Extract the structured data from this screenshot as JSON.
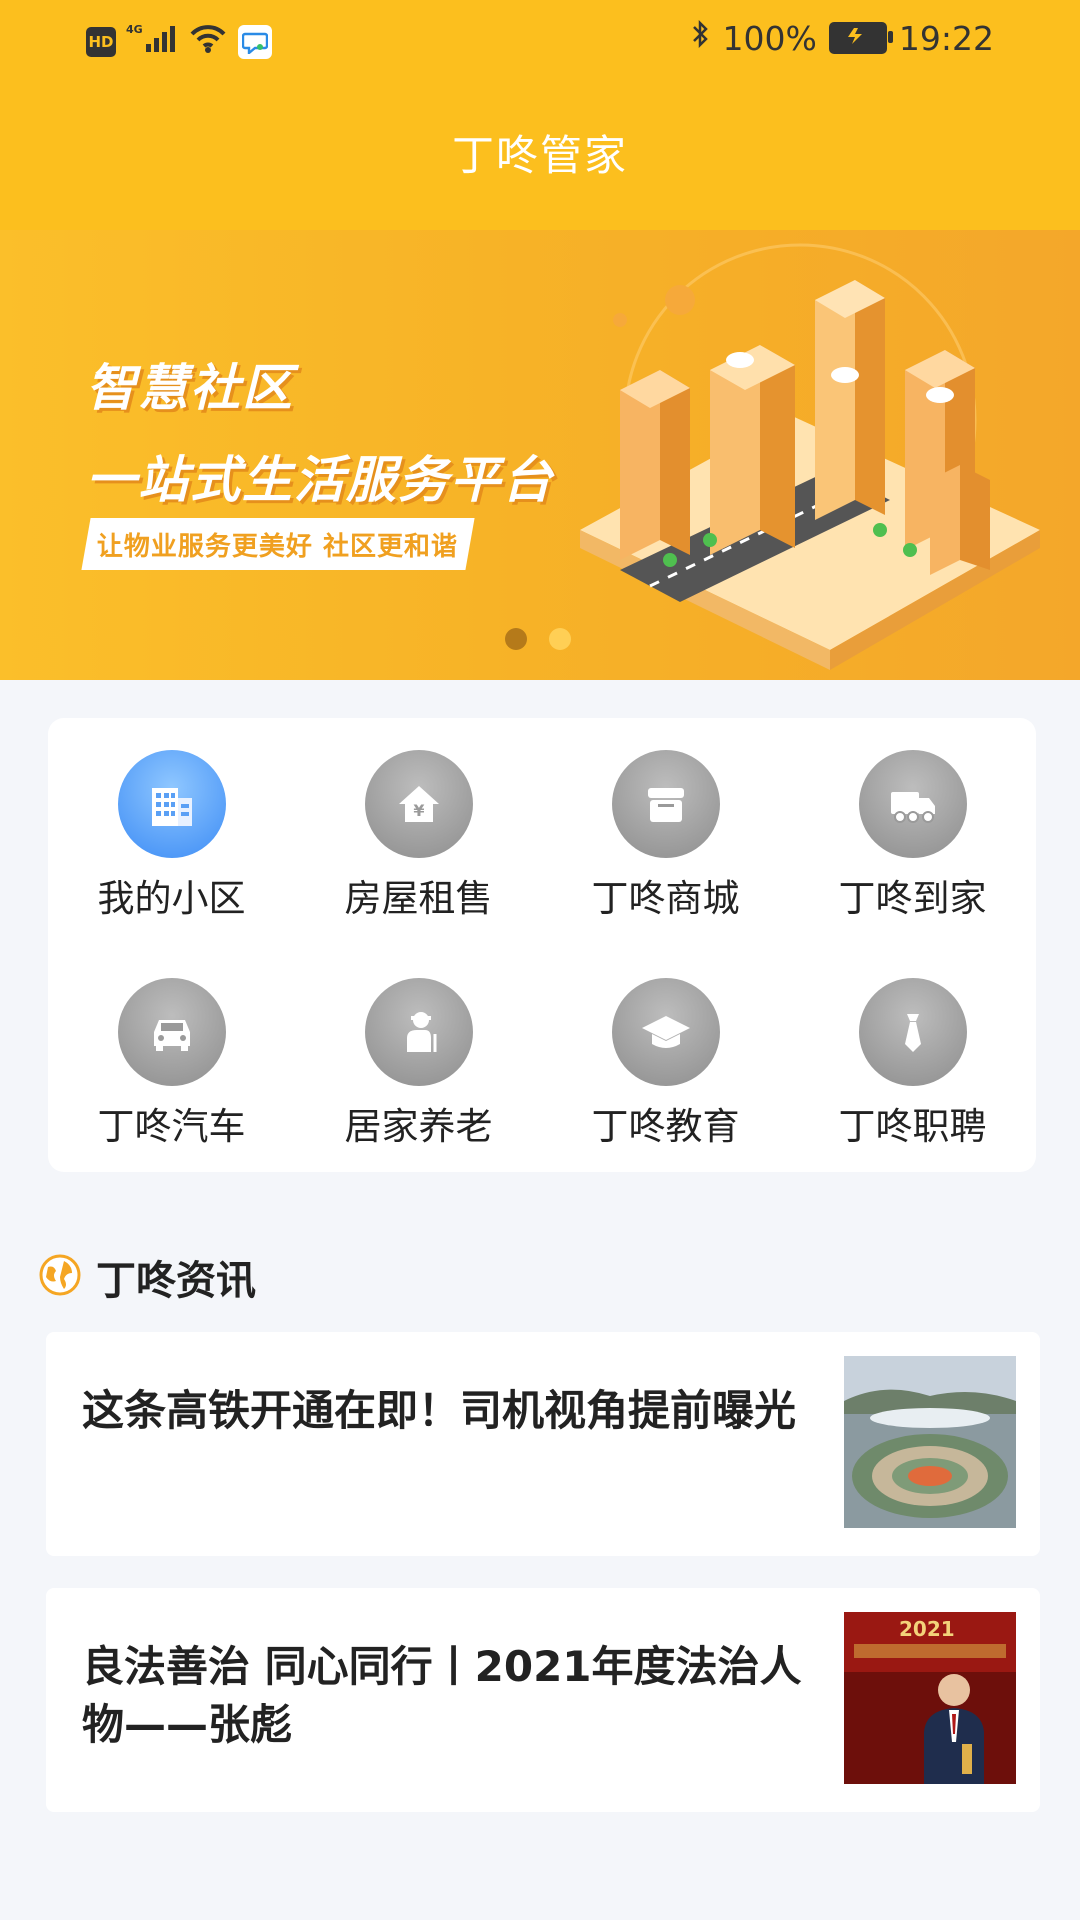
{
  "status_bar": {
    "hd_label": "HD",
    "network_label": "4G",
    "battery_percent": "100%",
    "time": "19:22"
  },
  "header": {
    "title": "丁咚管家"
  },
  "banner": {
    "headline1": "智慧社区",
    "headline2": "一站式生活服务平台",
    "slogan": "让物业服务更美好  社区更和谐",
    "page_index": 1,
    "page_count": 2
  },
  "services": [
    {
      "label": "我的小区",
      "icon": "building-icon",
      "active": true
    },
    {
      "label": "房屋租售",
      "icon": "house-yen-icon",
      "active": false
    },
    {
      "label": "丁咚商城",
      "icon": "store-icon",
      "active": false
    },
    {
      "label": "丁咚到家",
      "icon": "delivery-truck-icon",
      "active": false
    },
    {
      "label": "丁咚汽车",
      "icon": "car-icon",
      "active": false
    },
    {
      "label": "居家养老",
      "icon": "elderly-icon",
      "active": false
    },
    {
      "label": "丁咚教育",
      "icon": "graduation-cap-icon",
      "active": false
    },
    {
      "label": "丁咚职聘",
      "icon": "necktie-icon",
      "active": false
    }
  ],
  "news": {
    "section_title": "丁咚资讯",
    "items": [
      {
        "title": "这条高铁开通在即！司机视角提前曝光"
      },
      {
        "title": "良法善治 同心同行丨2021年度法治人物——张彪",
        "thumb_caption": "2021"
      }
    ]
  },
  "colors": {
    "brand_yellow": "#fcbf1e",
    "active_blue": "#3d8cf5",
    "inactive_gray": "#9a9a9a"
  }
}
